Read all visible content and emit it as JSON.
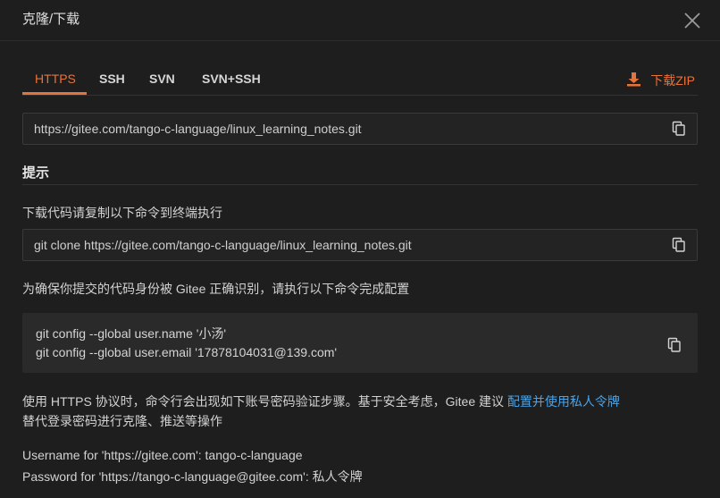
{
  "header": {
    "title": "克隆/下载"
  },
  "tabs": [
    {
      "label": "HTTPS",
      "active": true
    },
    {
      "label": "SSH",
      "active": false
    },
    {
      "label": "SVN",
      "active": false
    },
    {
      "label": "SVN+SSH",
      "active": false
    }
  ],
  "download": {
    "label": "下载ZIP",
    "icon": "download-icon"
  },
  "repo_url": "https://gitee.com/tango-c-language/linux_learning_notes.git",
  "tips": {
    "title": "提示",
    "clone_hint": "下载代码请复制以下命令到终端执行",
    "clone_command": "git clone https://gitee.com/tango-c-language/linux_learning_notes.git",
    "config_hint": "为确保你提交的代码身份被 Gitee 正确识别，请执行以下命令完成配置",
    "config_name": "git config --global user.name '小汤'",
    "config_email": "git config --global user.email '17878104031@139.com'",
    "https_note": "使用 HTTPS 协议时，命令行会出现如下账号密码验证步骤。基于安全考虑，Gitee 建议",
    "https_link": "配置并使用私人令牌",
    "https_note2": "替代登录密码进行克隆、推送等操作",
    "username_line": "Username for 'https://gitee.com': tango-c-language",
    "password_line": "Password for 'https://tango-c-language@gitee.com': 私人令牌"
  },
  "colors": {
    "accent": "#e8733a",
    "link": "#4aa3e8",
    "background": "#1e1e1e"
  }
}
